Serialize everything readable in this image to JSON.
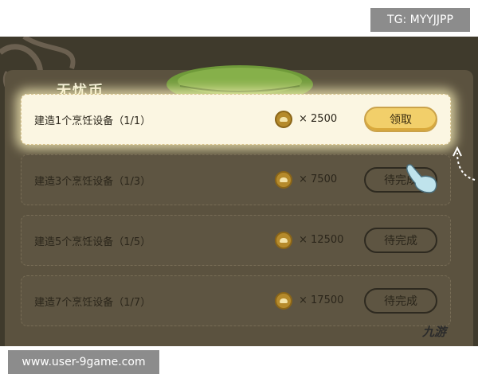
{
  "overlay": {
    "tg_text": "TG: MYYJJPP",
    "site_text": "www.user-9game.com",
    "corner_logo": "九游"
  },
  "panel": {
    "title": "无忧币"
  },
  "tasks": [
    {
      "label": "建造1个烹饪设备（1/1）",
      "reward": "× 2500",
      "status": "领取",
      "claimable": true
    },
    {
      "label": "建造3个烹饪设备（1/3）",
      "reward": "× 7500",
      "status": "待完成",
      "claimable": false
    },
    {
      "label": "建造5个烹饪设备（1/5）",
      "reward": "× 12500",
      "status": "待完成",
      "claimable": false
    },
    {
      "label": "建造7个烹饪设备（1/7）",
      "reward": "× 17500",
      "status": "待完成",
      "claimable": false
    }
  ],
  "icons": {
    "coin": "coin-icon",
    "hand": "pointing-hand-icon",
    "arrow": "curved-arrow-icon"
  },
  "colors": {
    "claim_button": "#f2cf6a",
    "panel_bg": "#5b523f",
    "highlight_row": "#fbf6e2",
    "leaf_banner": "#6f9a3a"
  }
}
